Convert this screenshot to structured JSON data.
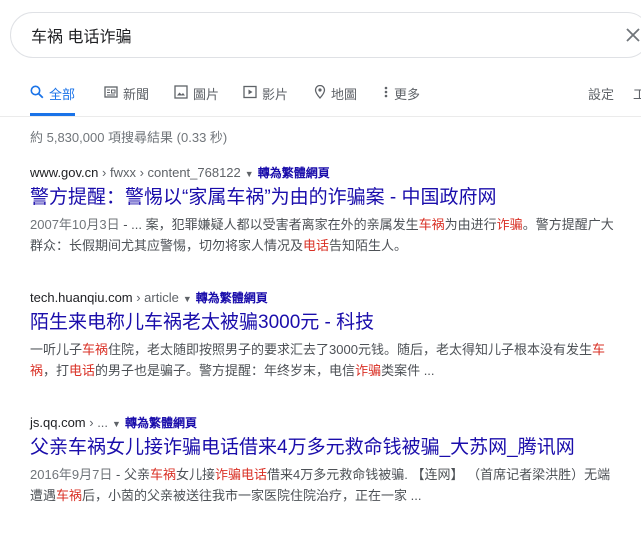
{
  "search": {
    "query": "车祸 电话诈骗"
  },
  "tabs": [
    {
      "label": "全部",
      "icon": "search-icon",
      "active": true
    },
    {
      "label": "新聞",
      "icon": "news-icon"
    },
    {
      "label": "圖片",
      "icon": "image-icon"
    },
    {
      "label": "影片",
      "icon": "video-icon"
    },
    {
      "label": "地圖",
      "icon": "map-pin-icon"
    },
    {
      "label": "更多",
      "icon": "more-icon"
    }
  ],
  "settings_label": "設定",
  "tools_label": "工",
  "stats": "約 5,830,000 項搜尋結果 (0.33 秒)",
  "translate_label": "轉為繁體網頁",
  "results": [
    {
      "domain": "www.gov.cn",
      "path": " › fwxx › content_768122",
      "title": "警方提醒：警惕以“家属车祸”为由的诈骗案 - 中国政府网",
      "snippet_date": "2007年10月3日",
      "snippet": [
        {
          "t": " - ... 案，犯罪嫌疑人都以受害者离家在外的亲属发生"
        },
        {
          "t": "车祸",
          "hl": true
        },
        {
          "t": "为由进行"
        },
        {
          "t": "诈骗",
          "hl": true
        },
        {
          "t": "。警方提醒广大群众：长假期间尤其应警惕，切勿将家人情况及"
        },
        {
          "t": "电话",
          "hl": true
        },
        {
          "t": "告知陌生人。"
        }
      ]
    },
    {
      "domain": "tech.huanqiu.com",
      "path": " › article",
      "title": "陌生来电称儿车祸老太被骗3000元 - 科技",
      "snippet_date": "",
      "snippet": [
        {
          "t": "一听儿子"
        },
        {
          "t": "车祸",
          "hl": true
        },
        {
          "t": "住院，老太随即按照男子的要求汇去了3000元钱。随后，老太得知儿子根本没有发生"
        },
        {
          "t": "车祸",
          "hl": true
        },
        {
          "t": "，打"
        },
        {
          "t": "电话",
          "hl": true
        },
        {
          "t": "的男子也是骗子。警方提醒：年终岁末，电信"
        },
        {
          "t": "诈骗",
          "hl": true
        },
        {
          "t": "类案件 ..."
        }
      ]
    },
    {
      "domain": "js.qq.com",
      "path": " › ...",
      "title": "父亲车祸女儿接诈骗电话借来4万多元救命钱被骗_大苏网_腾讯网",
      "snippet_date": "2016年9月7日",
      "snippet": [
        {
          "t": " - 父亲"
        },
        {
          "t": "车祸",
          "hl": true
        },
        {
          "t": "女儿接"
        },
        {
          "t": "诈骗电话",
          "hl": true
        },
        {
          "t": "借来4万多元救命钱被骗. 【连网】 （首席记者梁洪胜）无端遭遇"
        },
        {
          "t": "车祸",
          "hl": true
        },
        {
          "t": "后，小茵的父亲被送往我市一家医院住院治疗，正在一家 ..."
        }
      ]
    }
  ],
  "colors": {
    "link": "#1a0dab",
    "highlight": "#d93025",
    "accent": "#1a73e8"
  }
}
